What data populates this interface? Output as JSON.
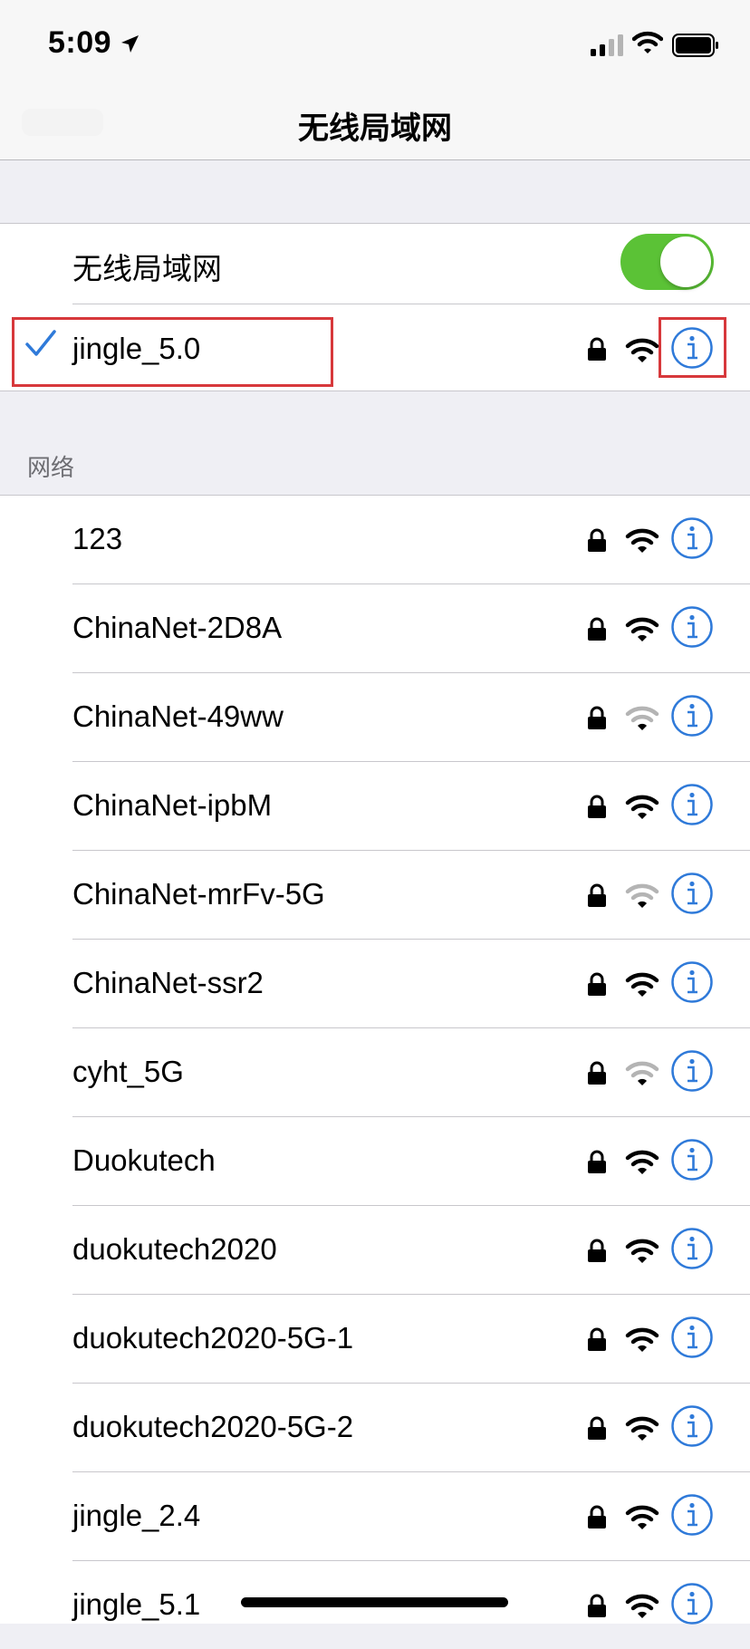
{
  "status_bar": {
    "time": "5:09"
  },
  "nav": {
    "title": "无线局域网"
  },
  "wifi_toggle": {
    "label": "无线局域网",
    "on": true
  },
  "connected": {
    "name": "jingle_5.0",
    "secured": true,
    "signal": "strong"
  },
  "section": {
    "header": "网络"
  },
  "networks": [
    {
      "name": "123",
      "signal": "strong"
    },
    {
      "name": "ChinaNet-2D8A",
      "signal": "strong"
    },
    {
      "name": "ChinaNet-49ww",
      "signal": "weak"
    },
    {
      "name": "ChinaNet-ipbM",
      "signal": "strong"
    },
    {
      "name": "ChinaNet-mrFv-5G",
      "signal": "weak"
    },
    {
      "name": "ChinaNet-ssr2",
      "signal": "strong"
    },
    {
      "name": "cyht_5G",
      "signal": "weak"
    },
    {
      "name": "Duokutech",
      "signal": "strong"
    },
    {
      "name": "duokutech2020",
      "signal": "strong"
    },
    {
      "name": "duokutech2020-5G-1",
      "signal": "strong"
    },
    {
      "name": "duokutech2020-5G-2",
      "signal": "strong"
    },
    {
      "name": "jingle_2.4",
      "signal": "strong"
    },
    {
      "name": "jingle_5.1",
      "signal": "strong"
    }
  ],
  "colors": {
    "accent": "#2f7ad9",
    "toggle_on": "#5bc236",
    "highlight": "#d7383b"
  }
}
